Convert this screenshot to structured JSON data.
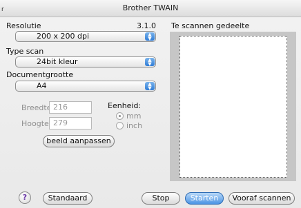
{
  "window": {
    "title": "Brother TWAIN",
    "corner_mark": "r"
  },
  "resolution": {
    "label": "Resolutie",
    "version": "3.1.0",
    "value": "200 x 200 dpi"
  },
  "scan_type": {
    "label": "Type scan",
    "value": "24bit kleur"
  },
  "document_size": {
    "label": "Documentgrootte",
    "value": "A4"
  },
  "dimensions": {
    "width_label": "Breedte:",
    "width_value": "216",
    "height_label": "Hoogte:",
    "height_value": "279",
    "unit_label": "Eenheid:",
    "unit_options": [
      "mm",
      "inch"
    ],
    "unit_selected": "mm"
  },
  "adjust_button": "beeld aanpassen",
  "preview": {
    "label": "Te scannen gedeelte"
  },
  "footer": {
    "help": "?",
    "standard_button": "Standaard",
    "stop_button": "Stop",
    "start_button": "Starten",
    "prescan_button": "Vooraf scannen"
  },
  "colors": {
    "accent": "#3b86da",
    "help_glyph": "#6b39a8"
  },
  "icons": {
    "select_arrows": "up-down-arrows-icon",
    "help": "help-icon"
  }
}
